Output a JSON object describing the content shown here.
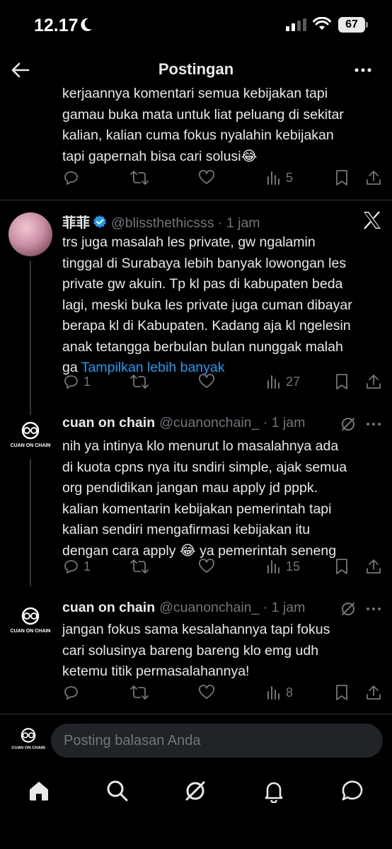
{
  "status_bar": {
    "time": "12.17",
    "battery": "67",
    "icons": [
      "moon-icon",
      "signal-icon",
      "wifi-icon",
      "battery-icon"
    ]
  },
  "header": {
    "title": "Postingan",
    "back_icon": "arrow-left-icon",
    "more_icon": "more-icon"
  },
  "tweets": [
    {
      "text_lines": [
        "kerjaannya komentari semua kebijakan tapi",
        "gamau buka mata untuk liat peluang di sekitar",
        "kalian, kalian cuma fokus nyalahin kebijakan",
        "tapi gapernah bisa cari solusi😂"
      ],
      "replies": "",
      "reposts": "",
      "likes": "",
      "views": "5"
    },
    {
      "name": "菲菲",
      "verified": true,
      "handle": "@blissthethicsss · 1 jam",
      "text_lines": [
        "trs juga masalah les private, gw ngalamin",
        "tinggal di Surabaya lebih banyak lowongan les",
        "private gw akuin. Tp kl pas di kabupaten beda",
        "lagi, meski buka les private juga cuman dibayar",
        "berapa kl di Kabupaten.  Kadang aja kl ngelesin",
        "anak tetangga berbulan bulan nunggak malah"
      ],
      "last_line_prefix": "ga",
      "show_more": "Tampilkan lebih banyak",
      "replies": "1",
      "reposts": "",
      "likes": "",
      "views": "27"
    },
    {
      "name": "cuan on chain",
      "handle": "@cuanonchain_ · 1 jam",
      "avatar_text": "CUAN ON CHAIN",
      "text_lines": [
        "nih ya intinya klo menurut lo masalahnya ada",
        "di kuota cpns nya itu sndiri simple, ajak semua",
        "org pendidikan jangan mau apply jd pppk.",
        "kalian komentarin kebijakan pemerintah tapi",
        "kalian sendiri mengafirmasi kebijakan itu",
        "dengan cara apply 😂 ya pemerintah seneng"
      ],
      "replies": "1",
      "reposts": "",
      "likes": "",
      "views": "15"
    },
    {
      "name": "cuan on chain",
      "handle": "@cuanonchain_ · 1 jam",
      "avatar_text": "CUAN ON CHAIN",
      "text_lines": [
        "jangan fokus sama kesalahannya tapi fokus",
        "cari solusinya bareng bareng klo emg udh",
        "ketemu titik permasalahannya!"
      ],
      "replies": "",
      "reposts": "",
      "likes": "",
      "views": "8"
    }
  ],
  "reply_bar": {
    "placeholder": "Posting balasan Anda",
    "avatar_text": "CUAN ON CHAIN"
  },
  "tabs": [
    "home-icon",
    "search-icon",
    "grok-icon",
    "notifications-icon",
    "messages-icon"
  ],
  "colors": {
    "background": "#000000",
    "text": "#e7e9ea",
    "muted": "#71767b",
    "link": "#1d9bf0",
    "divider": "#2f3336"
  }
}
